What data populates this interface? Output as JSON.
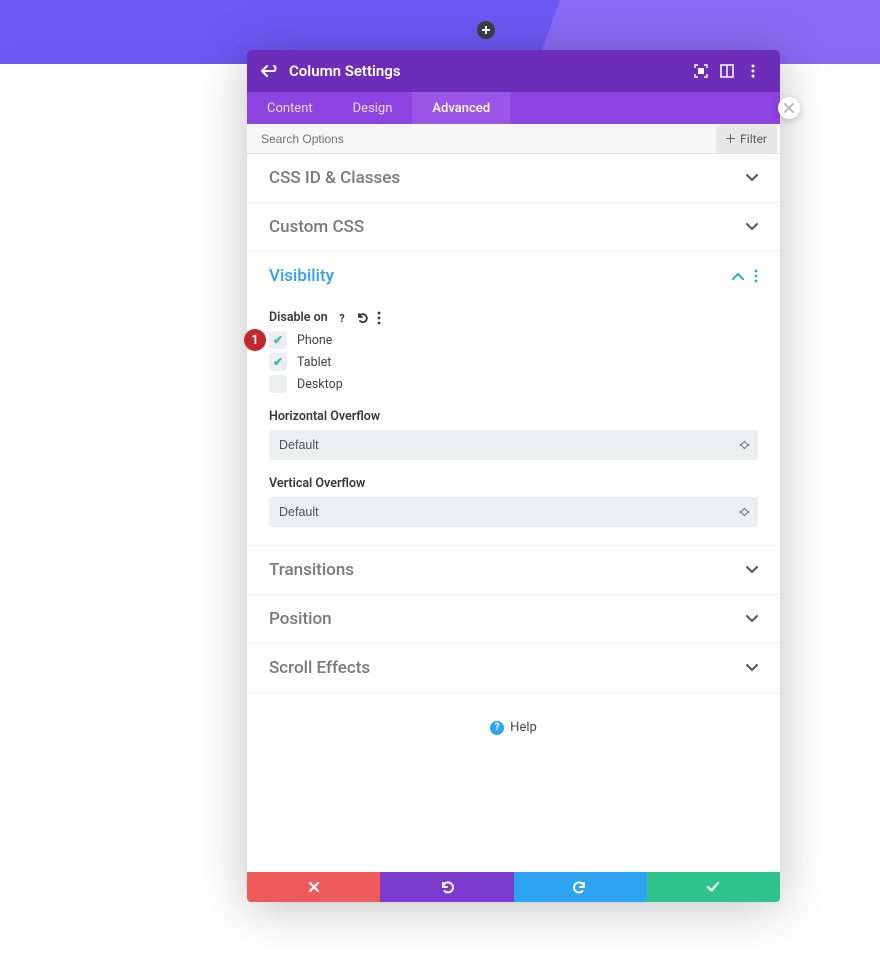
{
  "marker": "1",
  "header": {
    "title": "Column Settings"
  },
  "tabs": [
    "Content",
    "Design",
    "Advanced"
  ],
  "search": {
    "placeholder": "Search Options",
    "filter_label": "Filter"
  },
  "sections": {
    "cssid": {
      "title": "CSS ID & Classes"
    },
    "custom": {
      "title": "Custom CSS"
    },
    "visibility": {
      "title": "Visibility",
      "disable_label": "Disable on",
      "options": [
        {
          "label": "Phone",
          "checked": true
        },
        {
          "label": "Tablet",
          "checked": true
        },
        {
          "label": "Desktop",
          "checked": false
        }
      ],
      "h_overflow_label": "Horizontal Overflow",
      "h_overflow_value": "Default",
      "v_overflow_label": "Vertical Overflow",
      "v_overflow_value": "Default"
    },
    "transitions": {
      "title": "Transitions"
    },
    "position": {
      "title": "Position"
    },
    "scroll": {
      "title": "Scroll Effects"
    }
  },
  "help": {
    "label": "Help"
  }
}
